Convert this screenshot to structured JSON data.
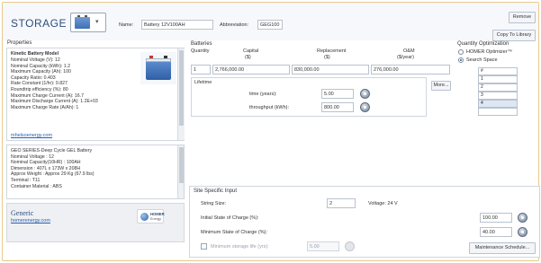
{
  "header": {
    "title": "STORAGE",
    "name_label": "Name:",
    "name_value": "Battery 12V100AH",
    "abbreviation_label": "Abbreviation:",
    "abbreviation_value": "GEG100",
    "remove_label": "Remove",
    "copy_label": "Copy To Library"
  },
  "properties": {
    "heading": "Properties",
    "model_title": "Kinetic Battery Model",
    "lines": [
      "Nominal Voltage (V): 12",
      "Nominal Capacity (kWh): 1.2",
      "Maximum Capacity (Ah): 100",
      "Capacity Ratio: 0.403",
      "Rate Constant (1/hr): 0.827",
      "Roundtrip efficiency (%): 80",
      "Maximum Charge Current (A): 16.7",
      "Maximum Discharge Current (A): 1.2E+03",
      "Maximum Charge Rate (A/Ah): 1"
    ],
    "link": "mhelsoenergy.com",
    "description": [
      "GEO SERIES-Deep Cycle GEL Battery",
      "Nominal Voltage : 12",
      "Nominal Capacity(10HR) : 100AH",
      "Dimension : 407L x 173W x 208H",
      "Approx Weight : Approx 29 Kg (67.9 lbs)",
      "Terminal : T11",
      "Container Material : ABS"
    ],
    "generic_title": "Generic",
    "generic_link": "homerenergy.com",
    "logo_text": "HOMER",
    "logo_sub": "Energy"
  },
  "batteries": {
    "heading": "Batteries",
    "col_quantity": "Quantity",
    "col_capital": "Capital",
    "col_capital_unit": "($)",
    "col_replacement": "Replacement",
    "col_replacement_unit": "($)",
    "col_om": "O&M",
    "col_om_unit": "($/year)",
    "quantity": "1",
    "capital": "2,766,000.00",
    "replacement": "830,000.00",
    "om": "276,000.00",
    "more_label": "More...",
    "lifetime_heading": "Lifetime",
    "time_label": "time (years):",
    "time_value": "5.00",
    "throughput_label": "throughput (kWh):",
    "throughput_value": "800.00"
  },
  "optimization": {
    "heading": "Quantity Optimization",
    "option_homer": "HOMER Optimizer™",
    "option_search": "Search Space",
    "grid_header": "#",
    "grid_values": [
      "1",
      "2",
      "3",
      "4",
      ""
    ]
  },
  "site": {
    "heading": "Site Specific Input",
    "string_size_label": "String Size:",
    "string_size_value": "2",
    "voltage_label": "Voltage: 24 V",
    "initial_soc_label": "Initial State of Charge (%):",
    "initial_soc_value": "100.00",
    "min_soc_label": "Minimum State of Charge (%):",
    "min_soc_value": "40.00",
    "min_storage_label": "Minimum storage life (yrs):",
    "min_storage_value": "5.00",
    "maintenance_label": "Maintenance Schedule..."
  }
}
